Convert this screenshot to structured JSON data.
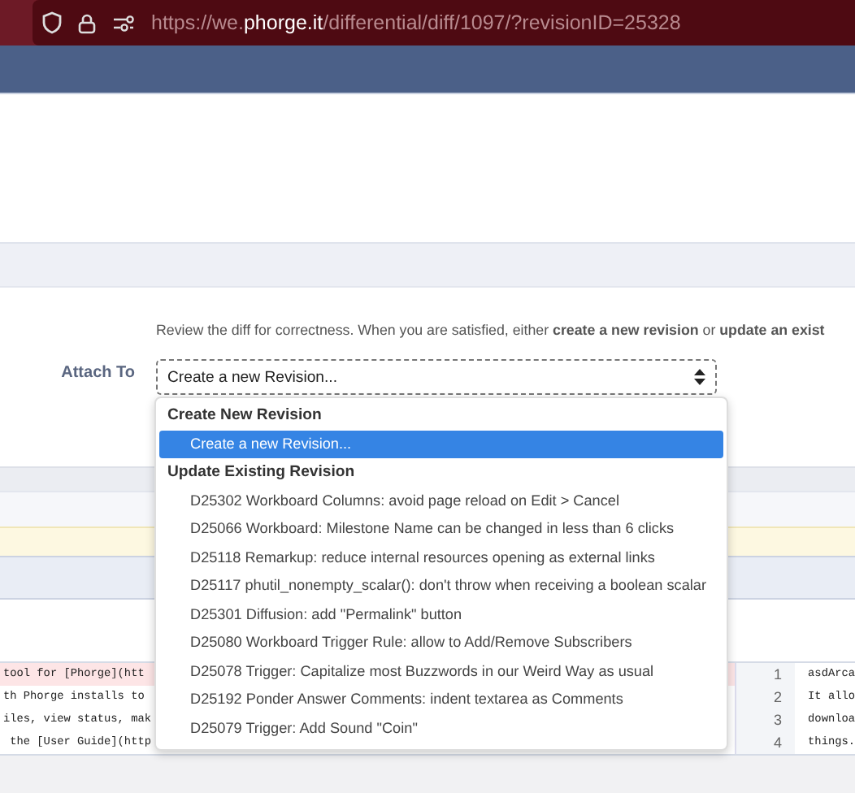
{
  "browser": {
    "url_prefix": "https://we.",
    "url_domain": "phorge.it",
    "url_path": "/differential/diff/1097/?revisionID=25328"
  },
  "form": {
    "description": "Review the diff for correctness. When you are satisfied, either **create a new revision** or **update an exist**",
    "label": "Attach To",
    "select_value": "Create a new Revision..."
  },
  "dropdown": {
    "groups": [
      {
        "heading": "Create New Revision",
        "options": [
          {
            "label": "Create a new Revision...",
            "selected": true
          }
        ]
      },
      {
        "heading": "Update Existing Revision",
        "options": [
          {
            "label": "D25302 Workboard Columns: avoid page reload on Edit > Cancel",
            "selected": false
          },
          {
            "label": "D25066 Workboard: Milestone Name can be changed in less than 6 clicks",
            "selected": false
          },
          {
            "label": "D25118 Remarkup: reduce internal resources opening as external links",
            "selected": false
          },
          {
            "label": "D25117 phutil_nonempty_scalar(): don't throw when receiving a boolean scalar",
            "selected": false
          },
          {
            "label": "D25301 Diffusion: add \"Permalink\" button",
            "selected": false
          },
          {
            "label": "D25080 Workboard Trigger Rule: allow to Add/Remove Subscribers",
            "selected": false
          },
          {
            "label": "D25078 Trigger: Capitalize most Buzzwords in our Weird Way as usual",
            "selected": false
          },
          {
            "label": "D25192 Ponder Answer Comments: indent textarea as Comments",
            "selected": false
          },
          {
            "label": "D25079 Trigger: Add Sound \"Coin\"",
            "selected": false
          }
        ]
      }
    ]
  },
  "diff": {
    "rows": [
      {
        "left": "tool for [Phorge](htt",
        "removed": true,
        "number": "1",
        "right": "asdArca"
      },
      {
        "left": "th Phorge installs to",
        "removed": false,
        "number": "2",
        "right": "It allo"
      },
      {
        "left": "iles, view status, mak",
        "removed": false,
        "number": "3",
        "right": "downloa"
      },
      {
        "left": " the [User Guide](http",
        "removed": false,
        "number": "4",
        "right": "things."
      }
    ]
  }
}
